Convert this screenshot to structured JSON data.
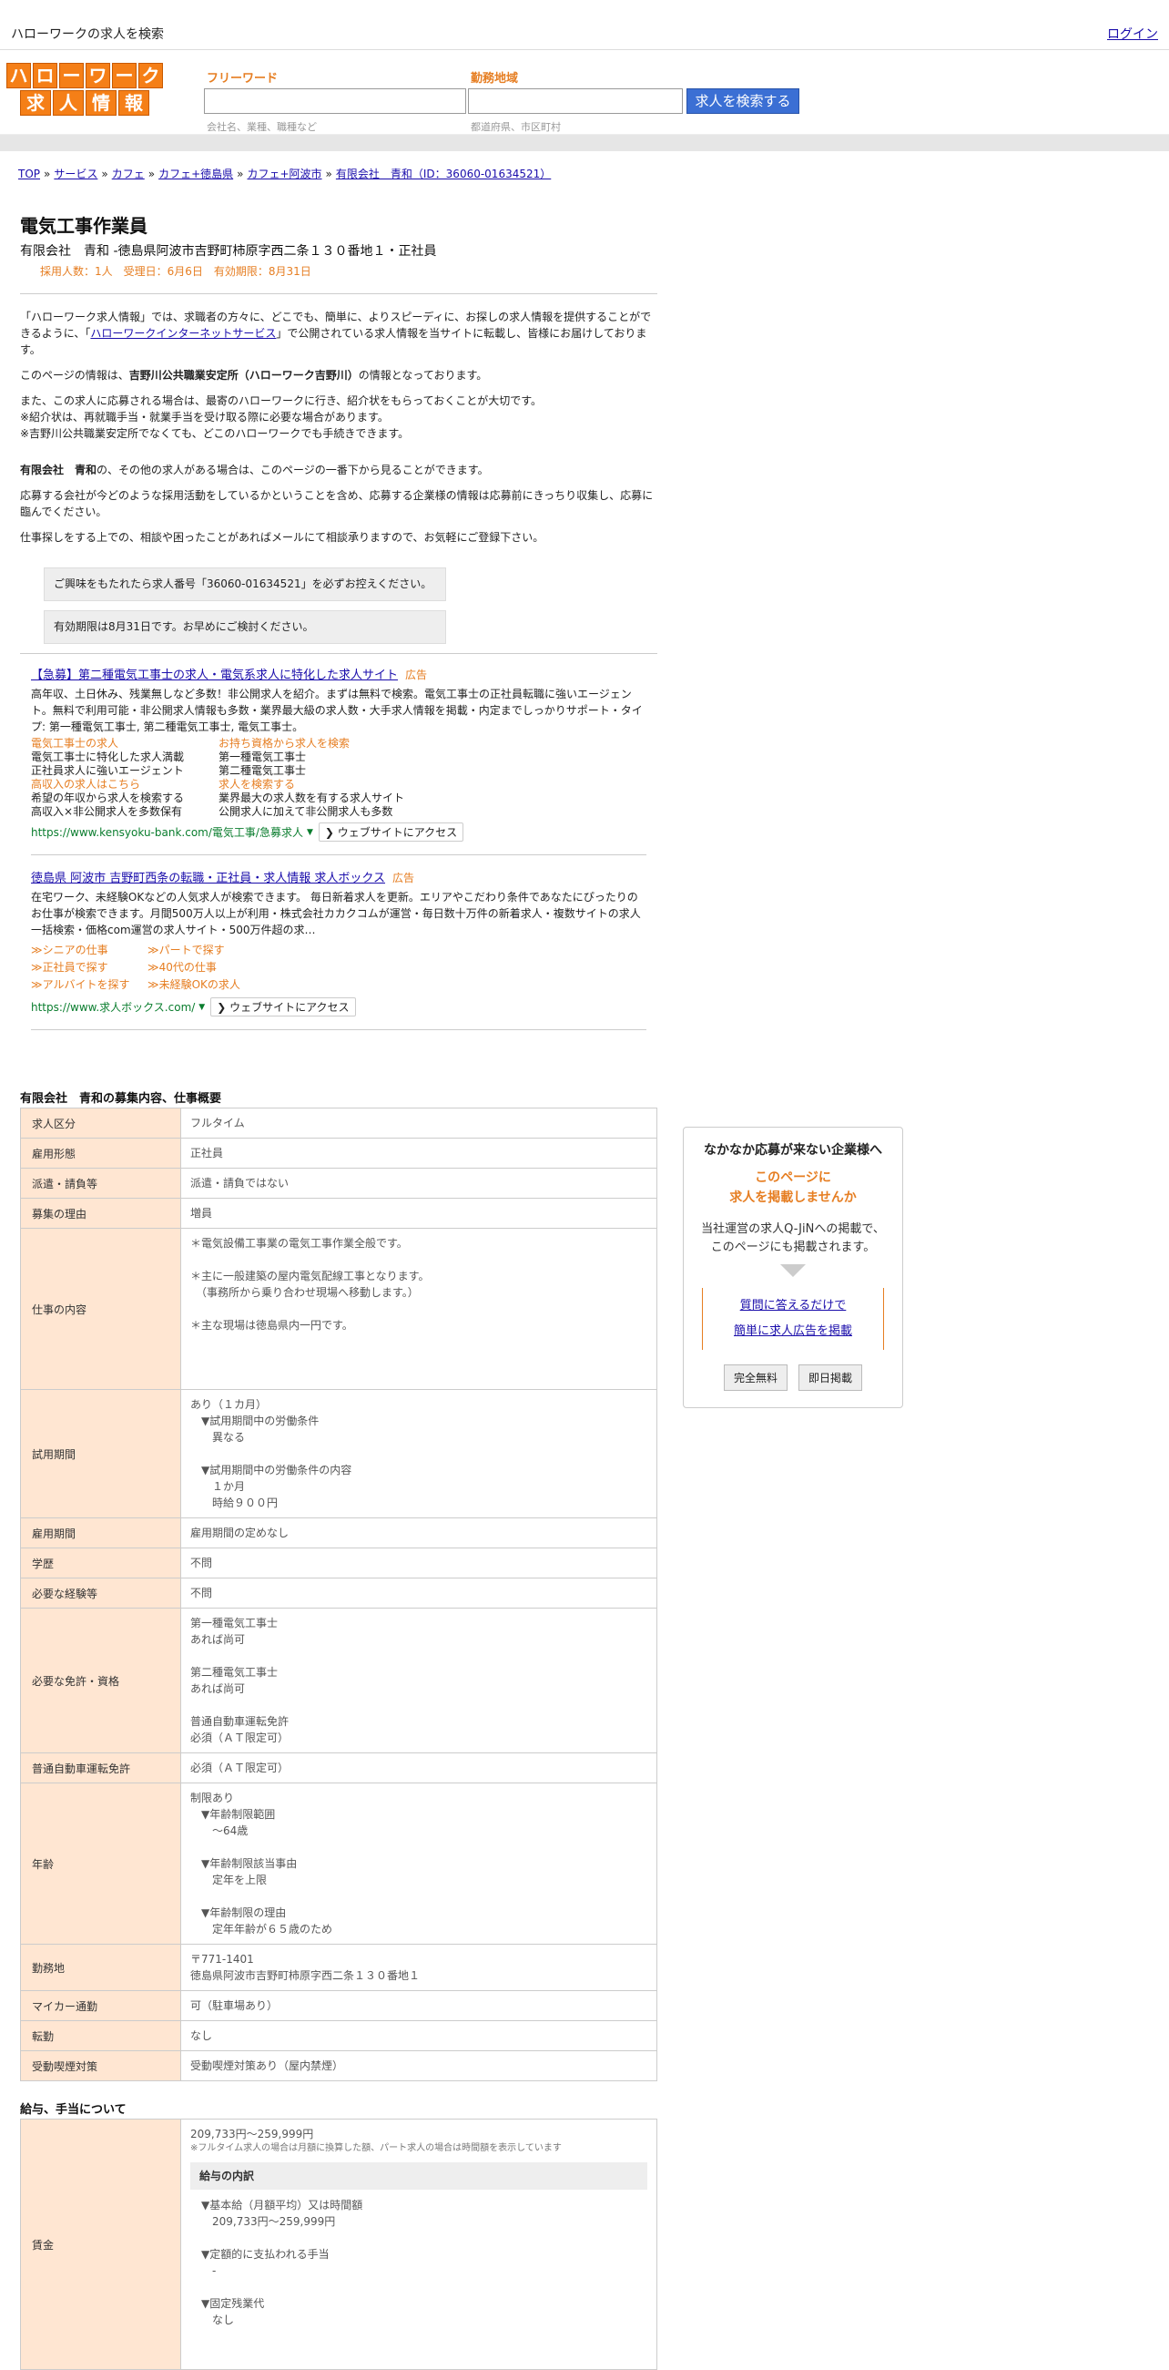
{
  "header": {
    "title": "ハローワークの求人を検索",
    "login": "ログイン"
  },
  "logo": {
    "row1": [
      "ハ",
      "ロ",
      "ー",
      "ワ",
      "ー",
      "ク"
    ],
    "row2": [
      "求",
      "人",
      "情",
      "報"
    ]
  },
  "search": {
    "keyword_label": "フリーワード",
    "keyword_hint": "会社名、業種、職種など",
    "area_label": "勤務地域",
    "area_hint": "都道府県、市区町村",
    "button": "求人を検索する"
  },
  "breadcrumb": {
    "items": [
      "TOP",
      "サービス",
      "カフェ",
      "カフェ+徳島県",
      "カフェ+阿波市",
      "有限会社　青和（ID：36060-01634521）"
    ],
    "separator": "»"
  },
  "job": {
    "title": "電気工事作業員",
    "company_line": "有限会社　青和 -徳島県阿波市吉野町柿原字西二条１３０番地１・正社員",
    "meta": "採用人数：1人　受理日：6月6日　有効期限：8月31日"
  },
  "intro": {
    "p1_a": "「ハローワーク求人情報」では、求職者の方々に、どこでも、簡単に、よりスピーディに、お探しの求人情報を提供することができるように、「",
    "p1_link": "ハローワークインターネットサービス",
    "p1_b": "」で公開されている求人情報を当サイトに転載し、皆様にお届けしております。",
    "p2_a": "このページの情報は、",
    "p2_bold": "吉野川公共職業安定所（ハローワーク吉野川）",
    "p2_b": "の情報となっております。",
    "p3": [
      "また、この求人に応募される場合は、最寄のハローワークに行き、紹介状をもらっておくことが大切です。",
      "※紹介状は、再就職手当・就業手当を受け取る際に必要な場合があります。",
      "※吉野川公共職業安定所でなくても、どこのハローワークでも手続きできます。"
    ],
    "p4_bold": "有限会社　青和",
    "p4": "の、その他の求人がある場合は、このページの一番下から見ることができます。",
    "p5": "応募する会社が今どのような採用活動をしているかということを含め、応募する企業様の情報は応募前にきっちり収集し、応募に臨んでください。",
    "p6": "仕事探しをする上での、相談や困ったことがあればメールにて相談承りますので、お気軽にご登録下さい。",
    "notice1": "ご興味をもたれたら求人番号「36060-01634521」を必ずお控えください。",
    "notice2": "有効期限は8月31日です。お早めにご検討ください。"
  },
  "ads": [
    {
      "title": "【急募】第二種電気工事士の求人・電気系求人に特化した求人サイト",
      "badge": "広告",
      "desc": "高年収、土日休み、残業無しなど多数！非公開求人を紹介。まずは無料で検索。電気工事士の正社員転職に強いエージェント。無料で利用可能・非公開求人情報も多数・業界最大級の求人数・大手求人情報を掲載・内定までしっかりサポート・タイプ: 第一種電気工事士, 第二種電気工事士, 電気工事士。",
      "grid": [
        [
          "電気工事士の求人",
          "お持ち資格から求人を検索"
        ],
        [
          "電気工事士に特化した求人満載",
          "第一種電気工事士"
        ],
        [
          "正社員求人に強いエージェント",
          "第二種電気工事士"
        ],
        [
          "高収入の求人はこちら",
          "求人を検索する"
        ],
        [
          "希望の年収から求人を検索する",
          "業界最大の求人数を有する求人サイト"
        ],
        [
          "高収入×非公開求人を多数保有",
          "公開求人に加えて非公開求人も多数"
        ]
      ],
      "url": "https://www.kensyoku-bank.com/電気工事/急募求人",
      "access": "ウェブサイトにアクセス"
    },
    {
      "title": "徳島県 阿波市 吉野町西条の転職・正社員・求人情報 求人ボックス",
      "badge": "広告",
      "desc": "在宅ワーク、未経験OKなどの人気求人が検索できます。 毎日新着求人を更新。エリアやこだわり条件であなたにぴったりのお仕事が検索できます。月間500万人以上が利用・株式会社カカクコムが運営・毎日数十万件の新着求人・複数サイトの求人一括検索・価格com運営の求人サイト・500万件超の求…",
      "links": [
        "≫シニアの仕事",
        "≫パートで探す",
        "≫正社員で探す",
        "≫40代の仕事",
        "≫アルバイトを探す",
        "≫未経験OKの求人"
      ],
      "url": "https://www.求人ボックス.com/",
      "access": "ウェブサイトにアクセス"
    }
  ],
  "details": {
    "heading": "有限会社　青和の募集内容、仕事概要",
    "rows": [
      {
        "label": "求人区分",
        "lines": [
          "フルタイム"
        ]
      },
      {
        "label": "雇用形態",
        "lines": [
          "正社員"
        ]
      },
      {
        "label": "派遣・請負等",
        "lines": [
          "派遣・請負ではない"
        ]
      },
      {
        "label": "募集の理由",
        "lines": [
          "増員"
        ]
      },
      {
        "label": "仕事の内容",
        "lines": [
          "＊電気設備工事業の電気工事作業全般です。",
          "",
          "＊主に一般建築の屋内電気配線工事となります。",
          "　（事務所から乗り合わせ現場へ移動します。）",
          "",
          "＊主な現場は徳島県内一円です。",
          "",
          "",
          ""
        ]
      },
      {
        "label": "試用期間",
        "lines": [
          "あり（１カ月）",
          "　▼試用期間中の労働条件",
          "　　異なる",
          "",
          "　▼試用期間中の労働条件の内容",
          "　　１か月",
          "　　時給９００円"
        ]
      },
      {
        "label": "雇用期間",
        "lines": [
          "雇用期間の定めなし"
        ]
      },
      {
        "label": "学歴",
        "lines": [
          "不問"
        ]
      },
      {
        "label": "必要な経験等",
        "lines": [
          "不問"
        ]
      },
      {
        "label": "必要な免許・資格",
        "lines": [
          "第一種電気工事士",
          "あれば尚可",
          "",
          "第二種電気工事士",
          "あれば尚可",
          "",
          "普通自動車運転免許",
          "必須（ＡＴ限定可）"
        ]
      },
      {
        "label": "普通自動車運転免許",
        "lines": [
          "必須（ＡＴ限定可）"
        ]
      },
      {
        "label": "年齢",
        "lines": [
          "制限あり",
          "　▼年齢制限範囲",
          "　　〜64歳",
          "",
          "　▼年齢制限該当事由",
          "　　定年を上限",
          "",
          "　▼年齢制限の理由",
          "　　定年年齢が６５歳のため"
        ]
      },
      {
        "label": "勤務地",
        "lines": [
          "〒771-1401",
          "徳島県阿波市吉野町柿原字西二条１３０番地１"
        ]
      },
      {
        "label": "マイカー通勤",
        "lines": [
          "可（駐車場あり）"
        ]
      },
      {
        "label": "転勤",
        "lines": [
          "なし"
        ]
      },
      {
        "label": "受動喫煙対策",
        "lines": [
          "受動喫煙対策あり（屋内禁煙）"
        ]
      }
    ]
  },
  "salary": {
    "heading": "給与、手当について",
    "label": "賃金",
    "amount": "209,733円〜259,999円",
    "note": "※フルタイム求人の場合は月額に換算した額、パート求人の場合は時間額を表示しています",
    "breakdown_head": "給与の内訳",
    "breakdown": [
      "▼基本給（月額平均）又は時間額",
      "　209,733円〜259,999円",
      "",
      "▼定額的に支払われる手当",
      "　-",
      "",
      "▼固定残業代",
      "　なし"
    ]
  },
  "sidebar": {
    "heading": "なかなか応募が来ない企業様へ",
    "orange1": "このページに",
    "orange2": "求人を掲載しませんか",
    "p1": "当社運営の求人Q-JiNへの掲載で、",
    "p2": "このページにも掲載されます。",
    "link1": "質問に答えるだけで",
    "link2": "簡単に求人広告を掲載",
    "btn1": "完全無料",
    "btn2": "即日掲載"
  }
}
